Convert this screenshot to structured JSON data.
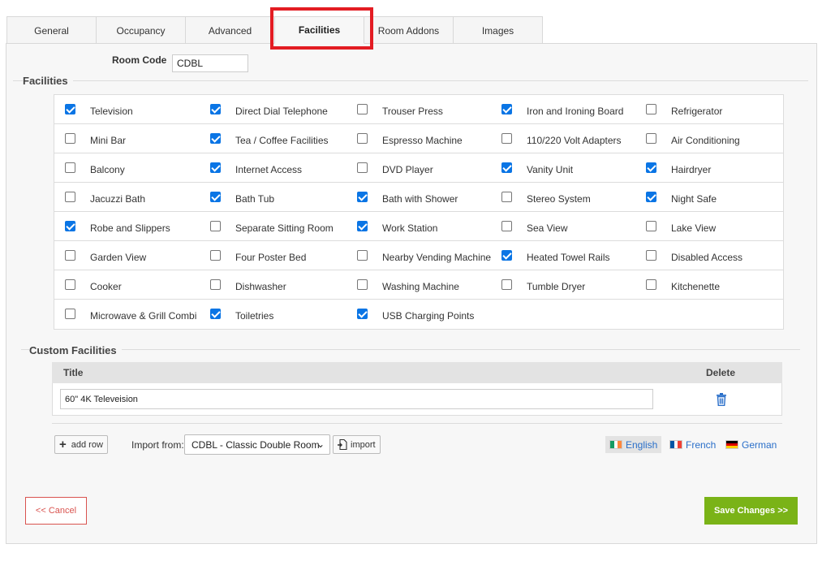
{
  "tabs": [
    {
      "label": "General",
      "active": false
    },
    {
      "label": "Occupancy",
      "active": false
    },
    {
      "label": "Advanced",
      "active": false
    },
    {
      "label": "Facilities",
      "active": true
    },
    {
      "label": "Room Addons",
      "active": false
    },
    {
      "label": "Images",
      "active": false
    }
  ],
  "room_code": {
    "label": "Room Code",
    "value": "CDBL"
  },
  "facilities": {
    "legend": "Facilities",
    "rows": [
      [
        {
          "label": "Television",
          "checked": true
        },
        {
          "label": "Direct Dial Telephone",
          "checked": true
        },
        {
          "label": "Trouser Press",
          "checked": false
        },
        {
          "label": "Iron and Ironing Board",
          "checked": true
        },
        {
          "label": "Refrigerator",
          "checked": false
        }
      ],
      [
        {
          "label": "Mini Bar",
          "checked": false
        },
        {
          "label": "Tea / Coffee Facilities",
          "checked": true
        },
        {
          "label": "Espresso Machine",
          "checked": false
        },
        {
          "label": "110/220 Volt Adapters",
          "checked": false
        },
        {
          "label": "Air Conditioning",
          "checked": false
        }
      ],
      [
        {
          "label": "Balcony",
          "checked": false
        },
        {
          "label": "Internet Access",
          "checked": true
        },
        {
          "label": "DVD Player",
          "checked": false
        },
        {
          "label": "Vanity Unit",
          "checked": true
        },
        {
          "label": "Hairdryer",
          "checked": true
        }
      ],
      [
        {
          "label": "Jacuzzi Bath",
          "checked": false
        },
        {
          "label": "Bath Tub",
          "checked": true
        },
        {
          "label": "Bath with Shower",
          "checked": true
        },
        {
          "label": "Stereo System",
          "checked": false
        },
        {
          "label": "Night Safe",
          "checked": true
        }
      ],
      [
        {
          "label": "Robe and Slippers",
          "checked": true
        },
        {
          "label": "Separate Sitting Room",
          "checked": false
        },
        {
          "label": "Work Station",
          "checked": true
        },
        {
          "label": "Sea View",
          "checked": false
        },
        {
          "label": "Lake View",
          "checked": false
        }
      ],
      [
        {
          "label": "Garden View",
          "checked": false
        },
        {
          "label": "Four Poster Bed",
          "checked": false
        },
        {
          "label": "Nearby Vending Machine",
          "checked": false
        },
        {
          "label": "Heated Towel Rails",
          "checked": true
        },
        {
          "label": "Disabled Access",
          "checked": false
        }
      ],
      [
        {
          "label": "Cooker",
          "checked": false
        },
        {
          "label": "Dishwasher",
          "checked": false
        },
        {
          "label": "Washing Machine",
          "checked": false
        },
        {
          "label": "Tumble Dryer",
          "checked": false
        },
        {
          "label": "Kitchenette",
          "checked": false
        }
      ],
      [
        {
          "label": "Microwave & Grill Combi",
          "checked": false
        },
        {
          "label": "Toiletries",
          "checked": true
        },
        {
          "label": "USB Charging Points",
          "checked": true
        }
      ]
    ]
  },
  "custom_facilities": {
    "legend": "Custom Facilities",
    "col_title": "Title",
    "col_delete": "Delete",
    "rows": [
      {
        "title": "60\" 4K Televeision",
        "delete_icon": "trash-icon"
      }
    ]
  },
  "actions": {
    "add_row": "add row",
    "import_from_label": "Import from:",
    "import_select_value": "CDBL - Classic Double Room",
    "import_button": "import"
  },
  "languages": [
    {
      "label": "English",
      "active": true,
      "colors": [
        "#169b62",
        "#ffffff",
        "#ff883e"
      ]
    },
    {
      "label": "French",
      "active": false,
      "colors": [
        "#0055a4",
        "#ffffff",
        "#ef4135"
      ]
    },
    {
      "label": "German",
      "active": false,
      "colors": [
        "#000000",
        "#dd0000",
        "#ffce00"
      ]
    }
  ],
  "footer": {
    "cancel": "<< Cancel",
    "save": "Save Changes >>"
  },
  "colors": {
    "accent_blue": "#0a75e5",
    "save_green": "#7ab317",
    "cancel_red": "#d9534f",
    "highlight_red": "#e31c23"
  }
}
